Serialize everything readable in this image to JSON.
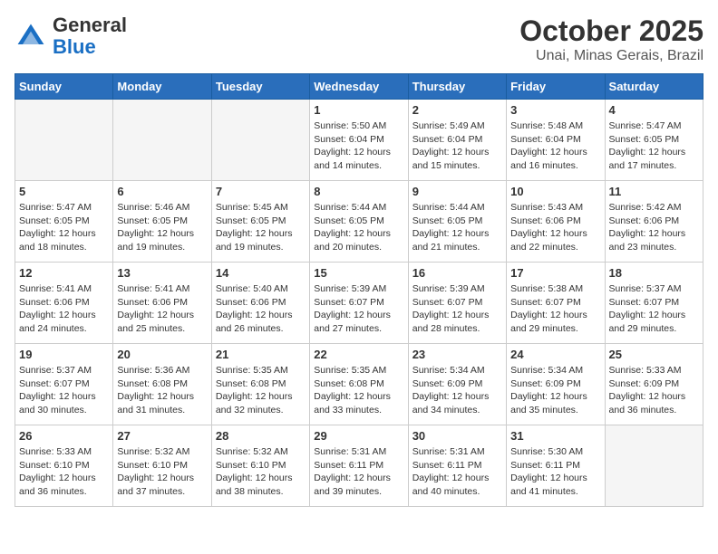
{
  "header": {
    "logo_general": "General",
    "logo_blue": "Blue",
    "month": "October 2025",
    "location": "Unai, Minas Gerais, Brazil"
  },
  "days_of_week": [
    "Sunday",
    "Monday",
    "Tuesday",
    "Wednesday",
    "Thursday",
    "Friday",
    "Saturday"
  ],
  "weeks": [
    [
      {
        "day": "",
        "info": ""
      },
      {
        "day": "",
        "info": ""
      },
      {
        "day": "",
        "info": ""
      },
      {
        "day": "1",
        "info": "Sunrise: 5:50 AM\nSunset: 6:04 PM\nDaylight: 12 hours\nand 14 minutes."
      },
      {
        "day": "2",
        "info": "Sunrise: 5:49 AM\nSunset: 6:04 PM\nDaylight: 12 hours\nand 15 minutes."
      },
      {
        "day": "3",
        "info": "Sunrise: 5:48 AM\nSunset: 6:04 PM\nDaylight: 12 hours\nand 16 minutes."
      },
      {
        "day": "4",
        "info": "Sunrise: 5:47 AM\nSunset: 6:05 PM\nDaylight: 12 hours\nand 17 minutes."
      }
    ],
    [
      {
        "day": "5",
        "info": "Sunrise: 5:47 AM\nSunset: 6:05 PM\nDaylight: 12 hours\nand 18 minutes."
      },
      {
        "day": "6",
        "info": "Sunrise: 5:46 AM\nSunset: 6:05 PM\nDaylight: 12 hours\nand 19 minutes."
      },
      {
        "day": "7",
        "info": "Sunrise: 5:45 AM\nSunset: 6:05 PM\nDaylight: 12 hours\nand 19 minutes."
      },
      {
        "day": "8",
        "info": "Sunrise: 5:44 AM\nSunset: 6:05 PM\nDaylight: 12 hours\nand 20 minutes."
      },
      {
        "day": "9",
        "info": "Sunrise: 5:44 AM\nSunset: 6:05 PM\nDaylight: 12 hours\nand 21 minutes."
      },
      {
        "day": "10",
        "info": "Sunrise: 5:43 AM\nSunset: 6:06 PM\nDaylight: 12 hours\nand 22 minutes."
      },
      {
        "day": "11",
        "info": "Sunrise: 5:42 AM\nSunset: 6:06 PM\nDaylight: 12 hours\nand 23 minutes."
      }
    ],
    [
      {
        "day": "12",
        "info": "Sunrise: 5:41 AM\nSunset: 6:06 PM\nDaylight: 12 hours\nand 24 minutes."
      },
      {
        "day": "13",
        "info": "Sunrise: 5:41 AM\nSunset: 6:06 PM\nDaylight: 12 hours\nand 25 minutes."
      },
      {
        "day": "14",
        "info": "Sunrise: 5:40 AM\nSunset: 6:06 PM\nDaylight: 12 hours\nand 26 minutes."
      },
      {
        "day": "15",
        "info": "Sunrise: 5:39 AM\nSunset: 6:07 PM\nDaylight: 12 hours\nand 27 minutes."
      },
      {
        "day": "16",
        "info": "Sunrise: 5:39 AM\nSunset: 6:07 PM\nDaylight: 12 hours\nand 28 minutes."
      },
      {
        "day": "17",
        "info": "Sunrise: 5:38 AM\nSunset: 6:07 PM\nDaylight: 12 hours\nand 29 minutes."
      },
      {
        "day": "18",
        "info": "Sunrise: 5:37 AM\nSunset: 6:07 PM\nDaylight: 12 hours\nand 29 minutes."
      }
    ],
    [
      {
        "day": "19",
        "info": "Sunrise: 5:37 AM\nSunset: 6:07 PM\nDaylight: 12 hours\nand 30 minutes."
      },
      {
        "day": "20",
        "info": "Sunrise: 5:36 AM\nSunset: 6:08 PM\nDaylight: 12 hours\nand 31 minutes."
      },
      {
        "day": "21",
        "info": "Sunrise: 5:35 AM\nSunset: 6:08 PM\nDaylight: 12 hours\nand 32 minutes."
      },
      {
        "day": "22",
        "info": "Sunrise: 5:35 AM\nSunset: 6:08 PM\nDaylight: 12 hours\nand 33 minutes."
      },
      {
        "day": "23",
        "info": "Sunrise: 5:34 AM\nSunset: 6:09 PM\nDaylight: 12 hours\nand 34 minutes."
      },
      {
        "day": "24",
        "info": "Sunrise: 5:34 AM\nSunset: 6:09 PM\nDaylight: 12 hours\nand 35 minutes."
      },
      {
        "day": "25",
        "info": "Sunrise: 5:33 AM\nSunset: 6:09 PM\nDaylight: 12 hours\nand 36 minutes."
      }
    ],
    [
      {
        "day": "26",
        "info": "Sunrise: 5:33 AM\nSunset: 6:10 PM\nDaylight: 12 hours\nand 36 minutes."
      },
      {
        "day": "27",
        "info": "Sunrise: 5:32 AM\nSunset: 6:10 PM\nDaylight: 12 hours\nand 37 minutes."
      },
      {
        "day": "28",
        "info": "Sunrise: 5:32 AM\nSunset: 6:10 PM\nDaylight: 12 hours\nand 38 minutes."
      },
      {
        "day": "29",
        "info": "Sunrise: 5:31 AM\nSunset: 6:11 PM\nDaylight: 12 hours\nand 39 minutes."
      },
      {
        "day": "30",
        "info": "Sunrise: 5:31 AM\nSunset: 6:11 PM\nDaylight: 12 hours\nand 40 minutes."
      },
      {
        "day": "31",
        "info": "Sunrise: 5:30 AM\nSunset: 6:11 PM\nDaylight: 12 hours\nand 41 minutes."
      },
      {
        "day": "",
        "info": ""
      }
    ]
  ]
}
